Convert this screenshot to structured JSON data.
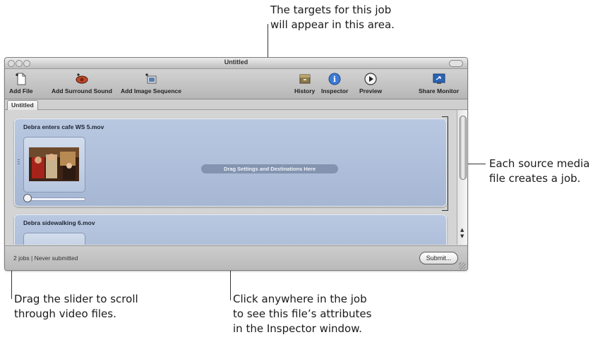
{
  "callouts": {
    "top": [
      "The targets for this job",
      "will appear in this area."
    ],
    "right": [
      "Each source media",
      "file creates a job."
    ],
    "bottom_left": [
      "Drag the slider to scroll",
      "through video files."
    ],
    "bottom_mid": [
      "Click anywhere in the job",
      "to see this file’s attributes",
      "in the Inspector window."
    ]
  },
  "window": {
    "title": "Untitled",
    "toolbar": {
      "add_file": "Add File",
      "add_surround": "Add Surround Sound",
      "add_image_seq": "Add Image Sequence",
      "history": "History",
      "inspector": "Inspector",
      "preview": "Preview",
      "share_monitor": "Share Monitor"
    },
    "tab": "Untitled",
    "jobs": [
      {
        "name": "Debra enters cafe WS 5.mov",
        "drop_text": "Drag Settings and Destinations Here"
      },
      {
        "name": "Debra sidewalking 6.mov"
      }
    ],
    "status": {
      "text": "2 jobs  |  Never submitted",
      "submit": "Submit..."
    }
  },
  "colors": {
    "job_bg": "#aebfdb",
    "window_bg": "#d4d4d4"
  }
}
